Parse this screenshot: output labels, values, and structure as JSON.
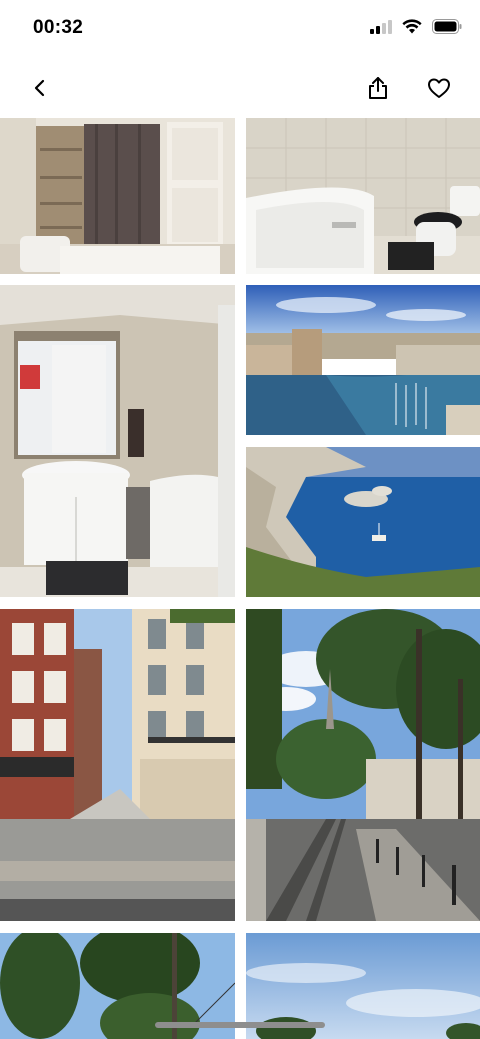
{
  "status_bar": {
    "time": "00:32",
    "icons": [
      "cellular-signal-icon",
      "wifi-icon",
      "battery-icon"
    ]
  },
  "nav": {
    "back_icon": "chevron-left-icon",
    "share_icon": "share-icon",
    "favorite_icon": "heart-outline-icon"
  },
  "gallery": {
    "photos": [
      {
        "subject": "bedroom"
      },
      {
        "subject": "bathroom-bathtub-toilet"
      },
      {
        "subject": "bathroom-sink-mirror"
      },
      {
        "subject": "old-port-harbor"
      },
      {
        "subject": "coastal-calanques"
      },
      {
        "subject": "street-buildings"
      },
      {
        "subject": "tree-lined-avenue-tram"
      },
      {
        "subject": "trees-sky"
      },
      {
        "subject": "sky-clouds"
      }
    ]
  },
  "colors": {
    "background": "#ffffff",
    "icon": "#000000",
    "home_indicator": "#8e8e8e"
  }
}
